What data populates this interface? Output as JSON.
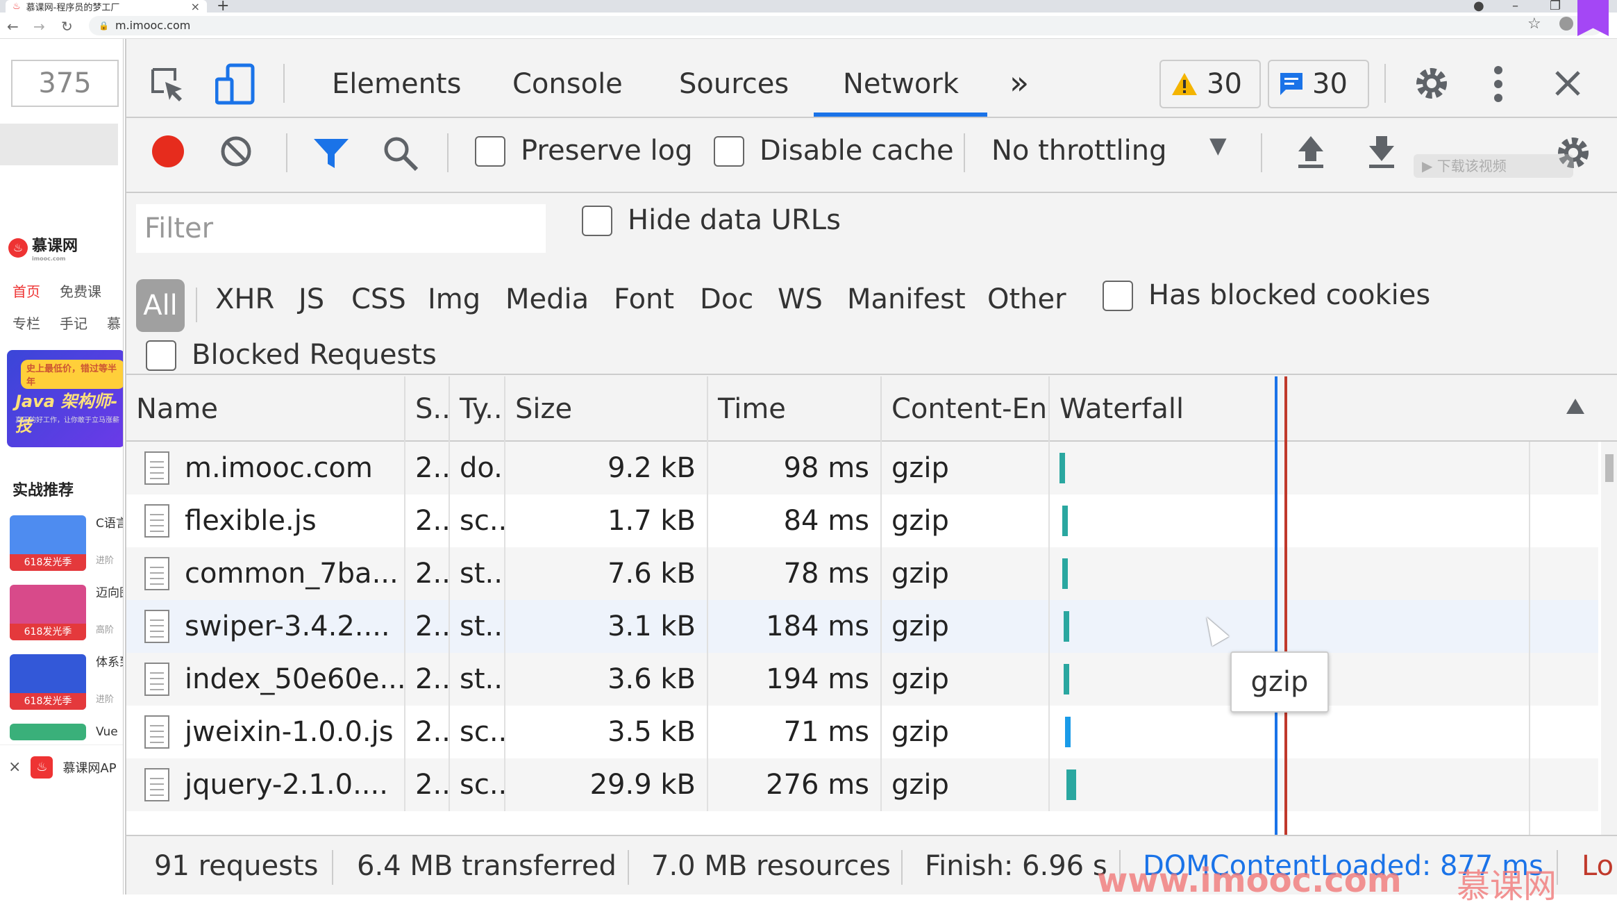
{
  "browser": {
    "tab_title": "慕课网-程序员的梦工厂",
    "url": "m.imooc.com"
  },
  "page": {
    "width_value": "375",
    "logo_text": "慕课网",
    "logo_sub": "imooc.com",
    "nav_top": [
      "首页",
      "免费课"
    ],
    "nav_bottom": [
      "专栏",
      "手记",
      "慕"
    ],
    "banner_tag": "史上最低价，错过等半年",
    "banner_title": "Java 架构师-技",
    "banner_sub": "真正的好工作，让你敢于立马涨薪",
    "rec_title": "实战推荐",
    "rec_items": [
      {
        "title": "C语言你的",
        "badge": "618发光季",
        "level": "进阶",
        "color": "#4e8cf0"
      },
      {
        "title": "迈向图课",
        "badge": "618发光季",
        "level": "高阶",
        "color": "#d84a8a"
      },
      {
        "title": "体系到精",
        "badge": "618发光季",
        "level": "进阶",
        "color": "#3358d8"
      }
    ],
    "next_item": "Vue",
    "app_bar_text": "慕课网AP"
  },
  "devtools": {
    "panel_tabs": [
      "Elements",
      "Console",
      "Sources",
      "Network"
    ],
    "active_tab": "Network",
    "more_tabs": "»",
    "warnings_count": "30",
    "messages_count": "30",
    "toolbar": {
      "preserve_log": "Preserve log",
      "disable_cache": "Disable cache",
      "throttling": "No throttling"
    },
    "filter": {
      "placeholder": "Filter",
      "hide_data_urls": "Hide data URLs",
      "types": [
        "All",
        "XHR",
        "JS",
        "CSS",
        "Img",
        "Media",
        "Font",
        "Doc",
        "WS",
        "Manifest",
        "Other"
      ],
      "has_blocked_cookies": "Has blocked cookies",
      "blocked_requests": "Blocked Requests"
    },
    "columns": [
      "Name",
      "S...",
      "Ty...",
      "Size",
      "Time",
      "Content-Encod...",
      "Waterfall"
    ],
    "rows": [
      {
        "name": "m.imooc.com",
        "status": "2...",
        "type": "do...",
        "size": "9.2 kB",
        "time": "98 ms",
        "encoding": "gzip"
      },
      {
        "name": "flexible.js",
        "status": "2...",
        "type": "sc...",
        "size": "1.7 kB",
        "time": "84 ms",
        "encoding": "gzip"
      },
      {
        "name": "common_7ba...",
        "status": "2...",
        "type": "st...",
        "size": "7.6 kB",
        "time": "78 ms",
        "encoding": "gzip"
      },
      {
        "name": "swiper-3.4.2....",
        "status": "2...",
        "type": "st...",
        "size": "3.1 kB",
        "time": "184 ms",
        "encoding": "gzip"
      },
      {
        "name": "index_50e60e...",
        "status": "2...",
        "type": "st...",
        "size": "3.6 kB",
        "time": "194 ms",
        "encoding": "gzip"
      },
      {
        "name": "jweixin-1.0.0.js",
        "status": "2...",
        "type": "sc...",
        "size": "3.5 kB",
        "time": "71 ms",
        "encoding": "gzip"
      },
      {
        "name": "jquery-2.1.0....",
        "status": "2...",
        "type": "sc...",
        "size": "29.9 kB",
        "time": "276 ms",
        "encoding": "gzip"
      }
    ],
    "tooltip": "gzip",
    "status": {
      "requests": "91 requests",
      "transferred": "6.4 MB transferred",
      "resources": "7.0 MB resources",
      "finish": "Finish: 6.96 s",
      "dcl": "DOMContentLoaded: 877 ms",
      "load": "Lo"
    }
  },
  "watermark": {
    "site": "www.imooc.com",
    "brand": "慕课网",
    "download": "▶ 下载该视频"
  },
  "colors": {
    "record": "#e62c1d",
    "active_tab": "#1a73e8",
    "filter_icon": "#1a73e8",
    "dcl_line": "#1a73e8",
    "load_line": "#c0392b"
  }
}
